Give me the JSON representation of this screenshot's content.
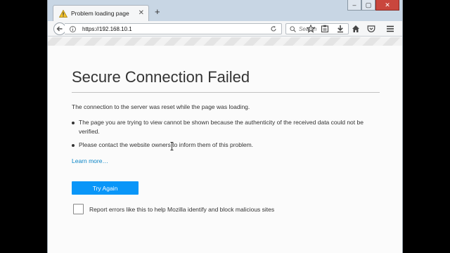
{
  "tab": {
    "title": "Problem loading page",
    "icon": "warning-icon",
    "close_glyph": "✕"
  },
  "newtab_glyph": "+",
  "window_controls": {
    "minimize": "–",
    "maximize": "▢",
    "close": "✕"
  },
  "navbar": {
    "url": "https://192.168.10.1",
    "search_placeholder": "Search",
    "icons": [
      "bookmark-star-icon",
      "reading-list-icon",
      "download-icon",
      "home-icon",
      "pocket-icon",
      "menu-icon"
    ]
  },
  "page": {
    "title": "Secure Connection Failed",
    "short_description": "The connection to the server was reset while the page was loading.",
    "bullets": [
      "The page you are trying to view cannot be shown because the authenticity of the received data could not be verified.",
      "Please contact the website owners to inform them of this problem."
    ],
    "learn_more": "Learn more…",
    "try_again": "Try Again",
    "report_label": "Report errors like this to help Mozilla identify and block malicious sites",
    "report_checked": false
  },
  "colors": {
    "accent": "#0996f8",
    "link": "#0a84c6",
    "tabbar": "#c8d6e4",
    "close": "#c9463d"
  }
}
